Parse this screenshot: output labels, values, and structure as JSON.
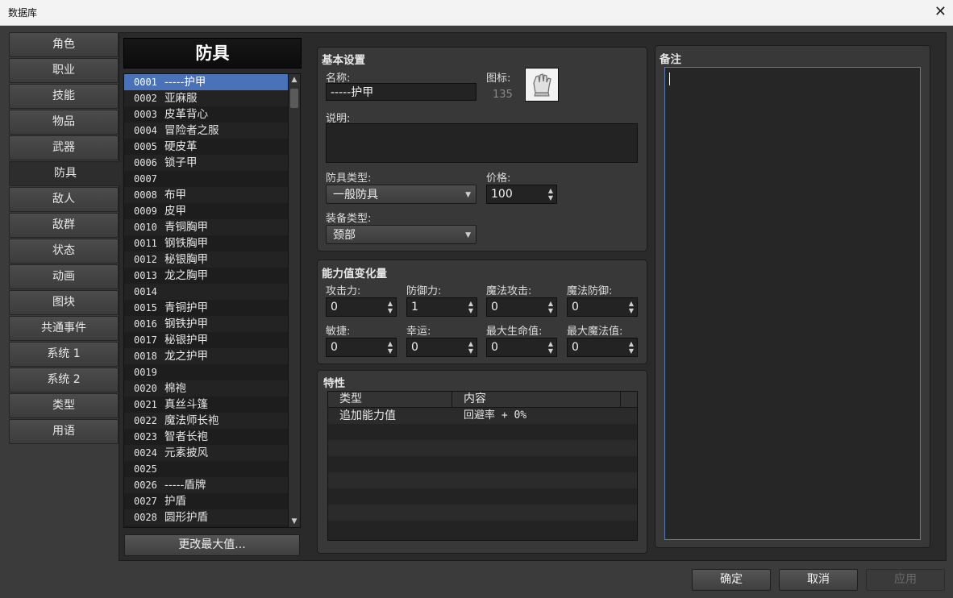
{
  "window": {
    "title": "数据库",
    "title_suffix": "",
    "close_glyph": "✕"
  },
  "categories": [
    {
      "label": "角色",
      "active": false
    },
    {
      "label": "职业",
      "active": false
    },
    {
      "label": "技能",
      "active": false
    },
    {
      "label": "物品",
      "active": false
    },
    {
      "label": "武器",
      "active": false
    },
    {
      "label": "防具",
      "active": true
    },
    {
      "label": "敌人",
      "active": false
    },
    {
      "label": "敌群",
      "active": false
    },
    {
      "label": "状态",
      "active": false
    },
    {
      "label": "动画",
      "active": false
    },
    {
      "label": "图块",
      "active": false
    },
    {
      "label": "共通事件",
      "active": false
    },
    {
      "label": "系统 1",
      "active": false
    },
    {
      "label": "系统 2",
      "active": false
    },
    {
      "label": "类型",
      "active": false
    },
    {
      "label": "用语",
      "active": false
    }
  ],
  "list": {
    "header": "防具",
    "change_max_label": "更改最大值...",
    "items": [
      {
        "id": "0001",
        "name": "-----护甲"
      },
      {
        "id": "0002",
        "name": "亚麻服"
      },
      {
        "id": "0003",
        "name": "皮革背心"
      },
      {
        "id": "0004",
        "name": "冒险者之服"
      },
      {
        "id": "0005",
        "name": "硬皮革"
      },
      {
        "id": "0006",
        "name": "锁子甲"
      },
      {
        "id": "0007",
        "name": ""
      },
      {
        "id": "0008",
        "name": "布甲"
      },
      {
        "id": "0009",
        "name": "皮甲"
      },
      {
        "id": "0010",
        "name": "青铜胸甲"
      },
      {
        "id": "0011",
        "name": "钢铁胸甲"
      },
      {
        "id": "0012",
        "name": "秘银胸甲"
      },
      {
        "id": "0013",
        "name": "龙之胸甲"
      },
      {
        "id": "0014",
        "name": ""
      },
      {
        "id": "0015",
        "name": "青铜护甲"
      },
      {
        "id": "0016",
        "name": "钢铁护甲"
      },
      {
        "id": "0017",
        "name": "秘银护甲"
      },
      {
        "id": "0018",
        "name": "龙之护甲"
      },
      {
        "id": "0019",
        "name": ""
      },
      {
        "id": "0020",
        "name": "棉袍"
      },
      {
        "id": "0021",
        "name": "真丝斗篷"
      },
      {
        "id": "0022",
        "name": "魔法师长袍"
      },
      {
        "id": "0023",
        "name": "智者长袍"
      },
      {
        "id": "0024",
        "name": "元素披风"
      },
      {
        "id": "0025",
        "name": ""
      },
      {
        "id": "0026",
        "name": "-----盾牌"
      },
      {
        "id": "0027",
        "name": "护盾"
      },
      {
        "id": "0028",
        "name": "圆形护盾"
      }
    ]
  },
  "basic": {
    "title": "基本设置",
    "name_label": "名称:",
    "name_value": "-----护甲",
    "icon_label": "图标:",
    "icon_index": "135",
    "desc_label": "说明:",
    "desc_value": "",
    "armor_type_label": "防具类型:",
    "armor_type_value": "一般防具",
    "price_label": "价格:",
    "price_value": "100",
    "equip_type_label": "装备类型:",
    "equip_type_value": "颈部"
  },
  "params": {
    "title": "能力值变化量",
    "fields": [
      {
        "label": "攻击力:",
        "value": "0"
      },
      {
        "label": "防御力:",
        "value": "1"
      },
      {
        "label": "魔法攻击:",
        "value": "0"
      },
      {
        "label": "魔法防御:",
        "value": "0"
      },
      {
        "label": "敏捷:",
        "value": "0"
      },
      {
        "label": "幸运:",
        "value": "0"
      },
      {
        "label": "最大生命值:",
        "value": "0"
      },
      {
        "label": "最大魔法值:",
        "value": "0"
      }
    ]
  },
  "traits": {
    "title": "特性",
    "col_type": "类型",
    "col_content": "内容",
    "rows": [
      {
        "type": "追加能力值",
        "content": "回避率 + 0%"
      }
    ]
  },
  "note": {
    "title": "备注",
    "value": ""
  },
  "buttons": {
    "ok": "确定",
    "cancel": "取消",
    "apply": "应用"
  }
}
